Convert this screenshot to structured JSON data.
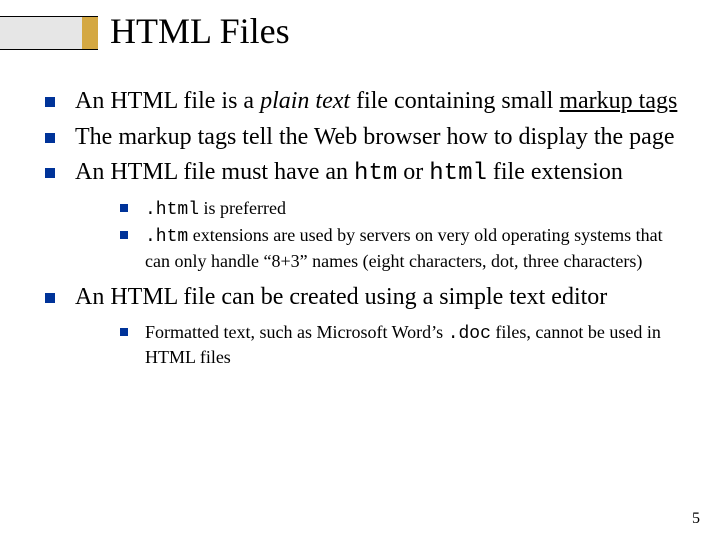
{
  "title": "HTML Files",
  "bullets": [
    {
      "pre": "An HTML file is a ",
      "em": "plain text",
      "mid": " file containing small ",
      "ul": "markup tags"
    },
    {
      "text": "The markup tags tell the Web browser how to display the page"
    },
    {
      "pre": "An HTML file must have an ",
      "code1": "htm",
      "mid": " or ",
      "code2": "html",
      "post": " file extension",
      "sub": [
        {
          "code": ".html",
          "post": " is preferred"
        },
        {
          "code": ".htm",
          "post": " extensions are used by servers on very old operating systems that can only handle “8+3” names (eight characters, dot, three characters)"
        }
      ]
    },
    {
      "text": "An HTML file can be created using a simple text editor",
      "sub": [
        {
          "pre": "Formatted text, such as Microsoft Word’s ",
          "code": ".doc",
          "post": " files, cannot be used in HTML files"
        }
      ]
    }
  ],
  "pageNumber": "5"
}
